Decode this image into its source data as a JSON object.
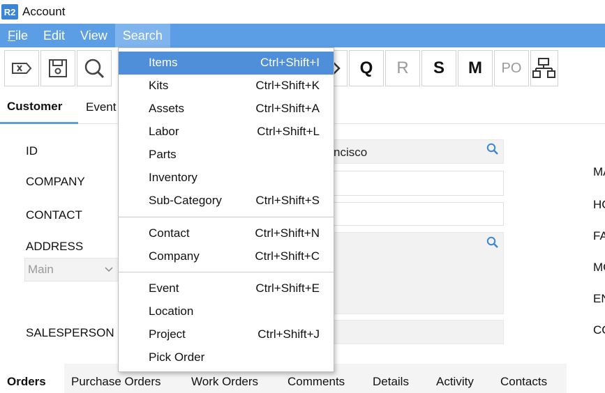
{
  "window": {
    "logo": "R2",
    "title": "Account"
  },
  "menubar": [
    {
      "label": "File",
      "underline": "F",
      "rest": "ile"
    },
    {
      "label": "Edit"
    },
    {
      "label": "View"
    },
    {
      "label": "Search"
    }
  ],
  "toolbar": {
    "icons": [
      "clear-tag-icon",
      "save-icon",
      "search-icon",
      "add-user-icon",
      "ticket-icon",
      "Q",
      "R",
      "S",
      "M",
      "PO",
      "network-icon"
    ],
    "letters": {
      "q": "Q",
      "r": "R",
      "s": "S",
      "m": "M",
      "po": "PO"
    }
  },
  "tabs": {
    "customer": "Customer",
    "events": "Event"
  },
  "form": {
    "id_label": "ID",
    "company_label": "COMPANY",
    "contact_label": "CONTACT",
    "address_label": "ADDRESS",
    "address_select": "Main",
    "salesperson_label": "SALESPERSON",
    "id_value": "ncisco"
  },
  "right_labels": [
    "MA",
    "HC",
    "FA",
    "MC",
    "EN",
    "CC"
  ],
  "bottom_tabs": [
    "Orders",
    "Purchase Orders",
    "Work Orders",
    "Comments",
    "Details",
    "Activity",
    "Contacts"
  ],
  "search_menu": {
    "group1": [
      {
        "label": "Items",
        "shortcut": "Ctrl+Shift+I"
      },
      {
        "label": "Kits",
        "shortcut": "Ctrl+Shift+K"
      },
      {
        "label": "Assets",
        "shortcut": "Ctrl+Shift+A"
      },
      {
        "label": "Labor",
        "shortcut": "Ctrl+Shift+L"
      },
      {
        "label": "Parts",
        "shortcut": ""
      },
      {
        "label": "Inventory",
        "shortcut": ""
      },
      {
        "label": "Sub-Category",
        "shortcut": "Ctrl+Shift+S"
      }
    ],
    "group2": [
      {
        "label": "Contact",
        "shortcut": "Ctrl+Shift+N"
      },
      {
        "label": "Company",
        "shortcut": "Ctrl+Shift+C"
      }
    ],
    "group3": [
      {
        "label": "Event",
        "shortcut": "Ctrl+Shift+E"
      },
      {
        "label": "Location",
        "shortcut": ""
      },
      {
        "label": "Project",
        "shortcut": "Ctrl+Shift+J"
      },
      {
        "label": "Pick Order",
        "shortcut": ""
      }
    ]
  },
  "colors": {
    "menubar": "#5b9ee6",
    "highlight": "#4f8fda",
    "accent": "#3a86d4"
  }
}
